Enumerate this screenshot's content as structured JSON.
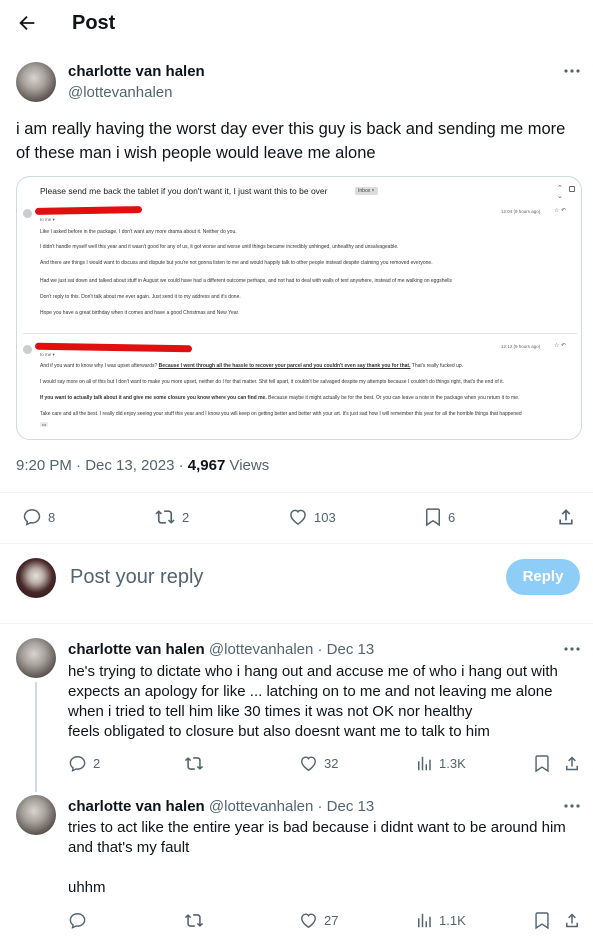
{
  "header": {
    "title": "Post"
  },
  "post": {
    "name": "charlotte van halen",
    "handle": "@lottevanhalen",
    "text": "i am really having the worst day ever this guy is back and sending me more of these man i wish people would leave me alone",
    "timestamp": "9:20 PM · Dec 13, 2023 · ",
    "views_count": "4,967",
    "views_label": " Views",
    "stats": {
      "replies": "8",
      "reposts": "2",
      "likes": "103",
      "bookmarks": "6"
    }
  },
  "email": {
    "subject": "Please send me back the tablet if you don't want it, I just want this to be over",
    "inbox_badge": "Inbox ×",
    "msg1": {
      "time": "12:04 (9 hours ago)",
      "to": "to me ▾",
      "lines": [
        "Like I asked before in the package. I don't want any more drama about it. Neither do you.",
        "I didn't handle myself well this year and it wasn't good for any of us, it got worse and worse until things became incredibly unhinged, unhealthy and unsalvageable.",
        "And there are things I would want to discuss and dispute but you're not gonna listen to me and would happily talk to other people instead despite claiming you removed everyone.",
        "Had we just sat down and talked about stuff in August we could have had a different outcome perhaps, and not had to deal with walls of text anywhere, instead of me walking on eggshells",
        "Don't reply to this. Don't talk about me ever again. Just send it to my address and it's done.",
        "Hope you have a great birthday when it comes and have a good Christmas and New Year."
      ]
    },
    "msg2": {
      "time": "12:12 (9 hours ago)",
      "to": "to me ▾",
      "line1_a": "And if you want to know why I was upset afterwards? ",
      "line1_b": "Because I went through all the hassle to recover your parcel and you couldn't even say thank you for that.",
      "line1_c": " That's really fucked up.",
      "line2": "I would say more on all of this but I don't want to make you more upset, neither do I for that matter. Shit fell apart, it couldn't be salvaged despite my attempts because I couldn't do things right, that's the end of it.",
      "line3_a": "If you want to actually talk about it and give me some closure you know where you can find me.",
      "line3_b": " Because maybe it might actually be for the best. Or you can leave a note in the package when you return it to me.",
      "line4": "Take care and all the best. I really did enjoy seeing your stuff this year and I know you will keep on getting better and better with your art. It's just sad how I will remember this year for all the horrible things that happened",
      "ellipsis": "•••"
    }
  },
  "reply_box": {
    "placeholder": "Post your reply",
    "button": "Reply"
  },
  "replies": [
    {
      "name": "charlotte van halen",
      "meta": "@lottevanhalen · Dec 13",
      "text": "he's trying to dictate who i hang out and accuse me of who i hang out with expects an apology for like ... latching on to me and not leaving me alone when i tried to tell him like 30 times it was not OK nor healthy\nfeels obligated to closure but also doesnt want me to talk to him",
      "stats": {
        "replies": "2",
        "reposts": "",
        "likes": "32",
        "views": "1.3K"
      }
    },
    {
      "name": "charlotte van halen",
      "meta": "@lottevanhalen · Dec 13",
      "text": "tries to act like the entire year is bad because i didnt want to be around him and that's my fault\n\nuhhm",
      "stats": {
        "replies": "",
        "reposts": "",
        "likes": "27",
        "views": "1.1K"
      }
    }
  ],
  "colors": {
    "accent": "#1d9bf0",
    "reply_button_disabled": "#8ecdf8",
    "muted": "#536471",
    "redaction": "#e01010"
  }
}
